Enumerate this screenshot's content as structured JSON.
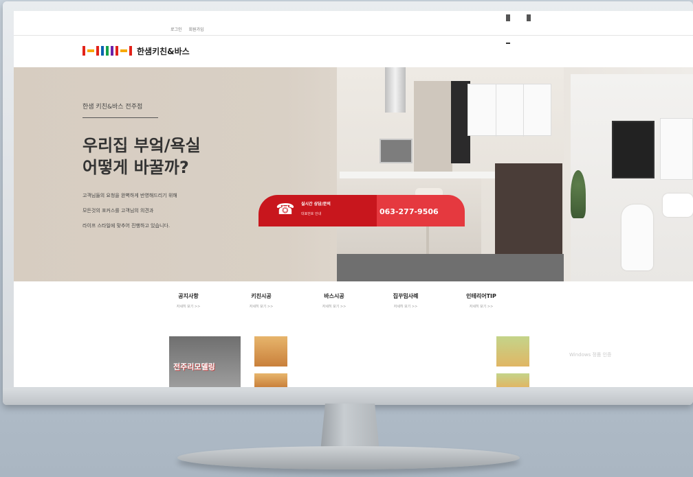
{
  "util": {
    "left_links": [
      "로그인",
      "회원가입"
    ],
    "right_top": "",
    "btn1": "",
    "btn2": "",
    "right_links": [
      "",
      "",
      "",
      ""
    ]
  },
  "brand": {
    "name": "한샘키친&바스",
    "colors": [
      "#e2231a",
      "#f7a900",
      "#0b62b0",
      "#16a34a",
      "#6b21a8"
    ]
  },
  "address": {
    "badge": "",
    "text": ""
  },
  "hero": {
    "subtitle": "한샘 키친&바스 전주점",
    "title_line1": "우리집 부엌/욕실",
    "title_line2": "어떻게 바꿀까?",
    "desc_line1": "고객님들의 요청을 완벽하게 반영해드리기 위해",
    "desc_line2": "모든것의 포커스를 고객님의 의견과",
    "desc_line3": "라이프 스타일에 맞추어 진행하고 있습니다."
  },
  "call": {
    "label": "실시간 상담/문의",
    "sub": "대표번호 안내",
    "store": "",
    "number": "063-277-9506",
    "icon": "phone-icon"
  },
  "nav": [
    {
      "title": "공지사항",
      "more": "자세히 보기 >>"
    },
    {
      "title": "키친시공",
      "more": "자세히 보기 >>"
    },
    {
      "title": "바스시공",
      "more": "자세히 보기 >>"
    },
    {
      "title": "집꾸밈사례",
      "more": "자세히 보기 >>"
    },
    {
      "title": "인테리어TIP",
      "more": "자세히 보기 >>"
    }
  ],
  "featured": {
    "label": "전주리모델링"
  },
  "news": [
    {
      "title": "",
      "snip": ""
    },
    {
      "title": "",
      "snip": ""
    },
    {
      "title": "",
      "snip": ""
    },
    {
      "title": "",
      "snip": ""
    }
  ],
  "watermark": {
    "line1": "Windows 정품 인증",
    "line2": ""
  }
}
